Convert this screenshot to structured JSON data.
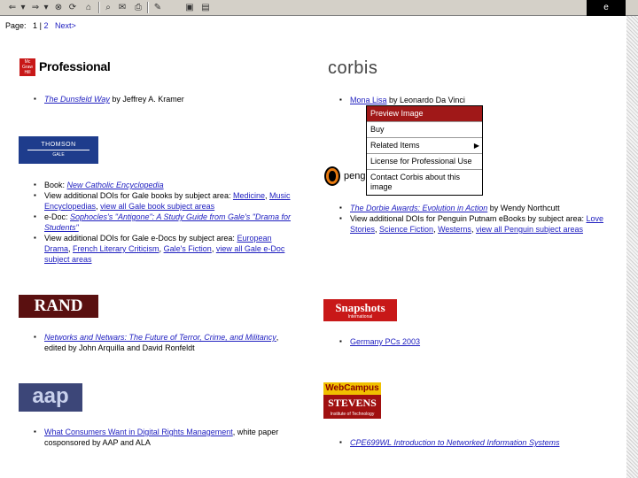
{
  "toolbar": {
    "buttons": [
      "⇐",
      "▾",
      "⇒",
      "▾",
      "⊗",
      "⟳",
      "⌂",
      "⌕",
      "✉",
      "⎙",
      "✎",
      "▣",
      "▤"
    ],
    "throbber": "e"
  },
  "pager": {
    "label": "Page:",
    "current": "1",
    "sep": "|",
    "page2": "2",
    "next": "Next>"
  },
  "colors": {
    "link": "#2020c0",
    "menu_highlight": "#a01818",
    "rand_bg": "#5a1010",
    "snapshots_bg": "#c81818",
    "thomson_bg": "#1e3c8c",
    "aap_bg": "#3c4678"
  },
  "logos": {
    "mcgraw": {
      "badge_line1": "Mc",
      "badge_line2": "Graw",
      "badge_line3": "Hill",
      "text": "Professional"
    },
    "corbis": {
      "text": "corbis"
    },
    "thomson": {
      "line1": "THOMSON",
      "line2": "GALE"
    },
    "penguin": {
      "text": "pengu"
    },
    "rand": {
      "text": "RAND"
    },
    "snapshots": {
      "line1": "Snapshots",
      "line2": "International"
    },
    "aap": {
      "text": "aap"
    },
    "webcampus": {
      "line1": "WebCampus",
      "line2": "STEVENS",
      "line3": "Institute of Technology"
    }
  },
  "mcgraw_list": [
    {
      "title": "The Dunsfeld Way",
      "by": " by Jeffrey A. Kramer"
    }
  ],
  "corbis_list": [
    {
      "title": "Mona Lisa",
      "by": " by Leonardo Da Vinci"
    }
  ],
  "gale_list": {
    "item1_prefix": "Book: ",
    "item1_link": "New Catholic Encyclopedia",
    "item2_prefix": "View additional DOIs for Gale books by subject area: ",
    "item2_link1": "Medicine",
    "item2_sep": ", ",
    "item2_link2": "Music Encyclopedias",
    "item2_link3": "view all Gale book subject areas",
    "item3_prefix": "e-Doc: ",
    "item3_link": "Sophocles's \"Antigone\": A Study Guide from Gale's \"Drama for Students\"",
    "item4_prefix": "View additional DOIs for Gale e-Docs by subject area: ",
    "item4_link1": "European Drama",
    "item4_link2": "French Literary Criticism",
    "item4_link3": "Gale's Fiction",
    "item4_link4": "view all Gale e-Doc subject areas"
  },
  "penguin_list": {
    "item1_link": "The Dorbie Awards: Evolution in Action",
    "item1_by": " by Wendy Northcutt",
    "item2_prefix": "View additional DOIs for Penguin Putnam eBooks by subject area: ",
    "item2_link1": "Love Stories",
    "item2_link2": "Science Fiction",
    "item2_link3": "Westerns",
    "item2_link4": "view all Penguin subject areas"
  },
  "rand_list": {
    "link": "Networks and Netwars: The Future of Terror, Crime, and Militancy",
    "rest": ", edited by John Arquilla and David Ronfeldt"
  },
  "snapshots_list": {
    "link": "Germany PCs 2003"
  },
  "aap_list": {
    "link": "What Consumers Want in Digital Rights Management",
    "rest": ", white paper cosponsored by AAP and ALA"
  },
  "webcampus_list": {
    "link": "CPE699WL Introduction to Networked Information Systems"
  },
  "context_menu": {
    "items": [
      "Preview Image",
      "Buy",
      "Related Items",
      "License for Professional Use",
      "Contact Corbis about this image"
    ],
    "submenu_arrow": "▶"
  }
}
